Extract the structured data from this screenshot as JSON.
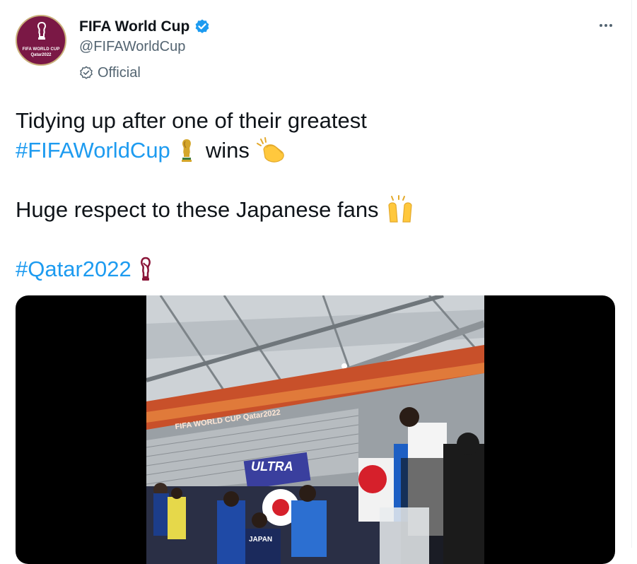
{
  "account": {
    "display_name": "FIFA World Cup",
    "handle": "@FIFAWorldCup",
    "badge_label": "Official",
    "avatar_text_line1": "FIFA WORLD CUP",
    "avatar_text_line2": "Qatar2022",
    "verified_color": "#1d9bf0"
  },
  "tweet": {
    "line1": "Tidying up after one of their greatest",
    "line2_hashtag": "#FIFAWorldCup",
    "line2_text": "wins",
    "line3": "Huge respect to these Japanese fans",
    "line4_hashtag": "#Qatar2022",
    "hashtag_color": "#1d9bf0",
    "emojis": [
      "trophy-emoji",
      "clapping-hands-emoji",
      "raising-hands-emoji",
      "qatar-emblem-emoji"
    ]
  },
  "media": {
    "type": "video",
    "stadium_banner": "FIFA WORLD CUP Qatar2022",
    "jersey_text": "JAPAN",
    "flag_banner_text": "ULTRA"
  },
  "icons": {
    "more": "more-options-icon",
    "verified": "verified-badge-icon",
    "official": "official-badge-icon"
  }
}
